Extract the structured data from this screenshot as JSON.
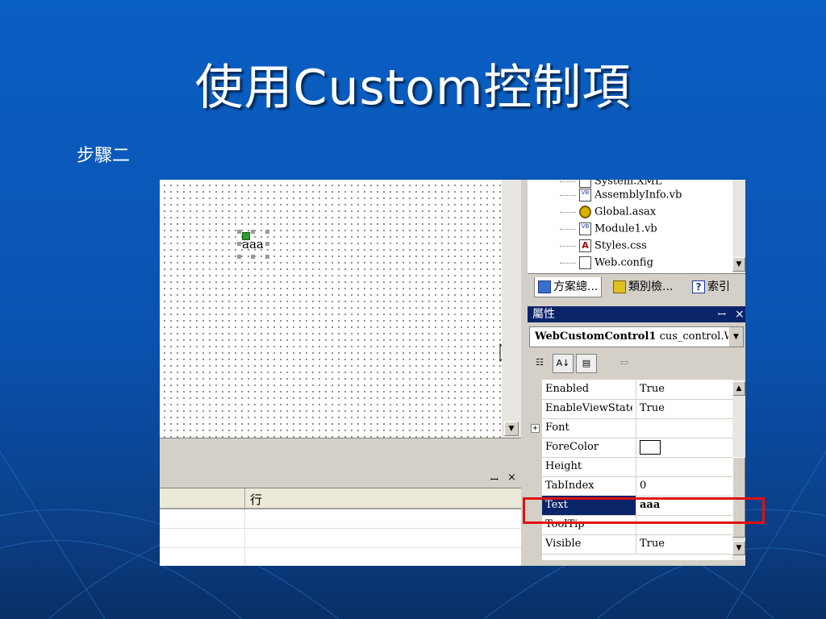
{
  "slide": {
    "title": "使用Custom控制項",
    "step": "步驟二"
  },
  "designer": {
    "control_text": "aaa"
  },
  "output_panel": {
    "pin": "ꟷ",
    "close": "×",
    "column_header": "行"
  },
  "solution_tree": {
    "items": [
      {
        "label": "System.XML",
        "icon": "reference-icon"
      },
      {
        "label": "AssemblyInfo.vb",
        "icon": "vb-file-icon"
      },
      {
        "label": "Global.asax",
        "icon": "global-asax-icon"
      },
      {
        "label": "Module1.vb",
        "icon": "vb-file-icon"
      },
      {
        "label": "Styles.css",
        "icon": "css-file-icon"
      },
      {
        "label": "Web.config",
        "icon": "config-file-icon"
      }
    ]
  },
  "tabs": [
    {
      "label": "方案總...",
      "icon": "solution-explorer-icon"
    },
    {
      "label": "類別檢...",
      "icon": "class-view-icon"
    },
    {
      "label": "索引",
      "icon": "help-index-icon"
    }
  ],
  "properties": {
    "title": "屬性",
    "pin": "ꟷ",
    "close": "×",
    "object_name": "WebCustomControl1",
    "object_type": "cus_control.W",
    "rows": [
      {
        "name": "Enabled",
        "value": "True"
      },
      {
        "name": "EnableViewState",
        "value": "True"
      },
      {
        "name": "Font",
        "value": "",
        "expandable": true
      },
      {
        "name": "ForeColor",
        "value": "",
        "color_swatch": "#ffffff"
      },
      {
        "name": "Height",
        "value": ""
      },
      {
        "name": "TabIndex",
        "value": "0"
      },
      {
        "name": "Text",
        "value": "aaa",
        "selected": true
      },
      {
        "name": "ToolTip",
        "value": ""
      },
      {
        "name": "Visible",
        "value": "True"
      }
    ]
  },
  "colors": {
    "highlight_border": "#e01010",
    "selection": "#0a246a"
  }
}
